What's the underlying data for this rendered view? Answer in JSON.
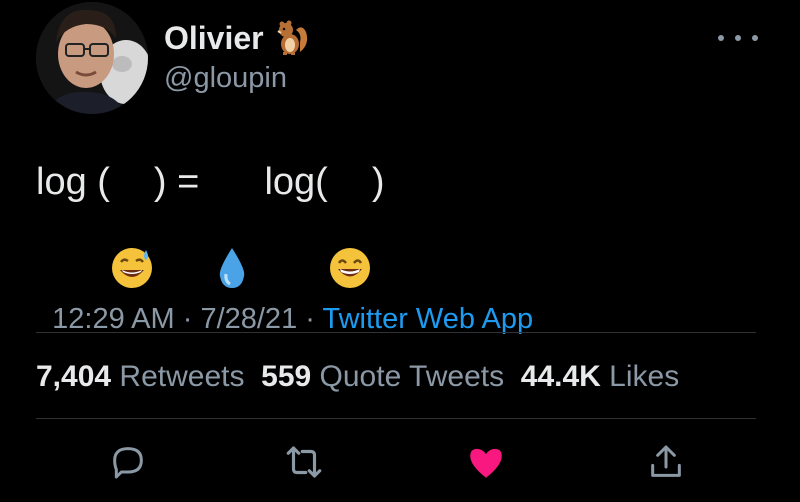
{
  "author": {
    "display_name": "Olivier",
    "handle": "@gloupin",
    "name_emoji": "chipmunk-icon"
  },
  "tweet": {
    "text_part1": "log (",
    "emoji1": "sweat-smile-emoji",
    "text_part2": ") = ",
    "emoji2": "droplet-emoji",
    "text_part3": " log(",
    "emoji3": "grinning-emoji",
    "text_part4": ")"
  },
  "meta": {
    "time": "12:29 AM",
    "sep1": " · ",
    "date": "7/28/21",
    "sep2": " · ",
    "source": "Twitter Web App"
  },
  "stats": {
    "retweets_count": "7,404",
    "retweets_label": " Retweets  ",
    "quotes_count": "559",
    "quotes_label": " Quote Tweets  ",
    "likes_count": "44.4K",
    "likes_label": " Likes"
  },
  "actions": [
    "reply-icon",
    "retweet-icon",
    "like-icon",
    "share-icon"
  ],
  "colors": {
    "background": "#000000",
    "text": "#e7e9ea",
    "muted": "#8b98a5",
    "link": "#1d9bf0",
    "like": "#f91880",
    "divider": "#2f3336"
  }
}
